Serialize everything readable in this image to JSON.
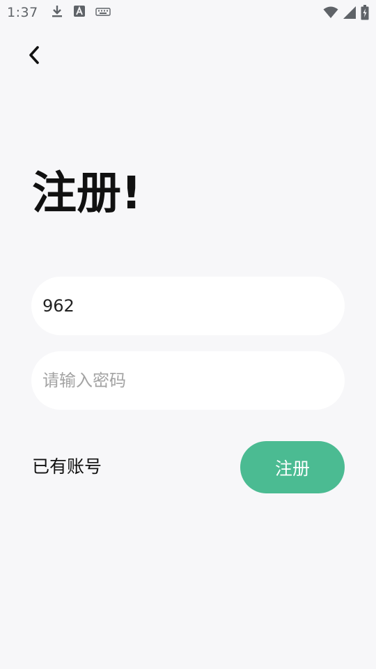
{
  "status_bar": {
    "time": "1:37",
    "icons_left": [
      "download-icon",
      "font-a-icon",
      "keyboard-icon"
    ],
    "icons_right": [
      "wifi-icon",
      "signal-icon",
      "battery-icon"
    ]
  },
  "header": {
    "back_icon": "chevron-left-icon"
  },
  "form": {
    "title": "注册!",
    "username": {
      "value": "962",
      "placeholder": ""
    },
    "password": {
      "value": "",
      "placeholder": "请输入密码"
    },
    "have_account_label": "已有账号",
    "register_label": "注册"
  },
  "colors": {
    "background": "#f7f7f9",
    "field_background": "#ffffff",
    "accent": "#4bbb92",
    "status_icon": "#5f6368"
  }
}
